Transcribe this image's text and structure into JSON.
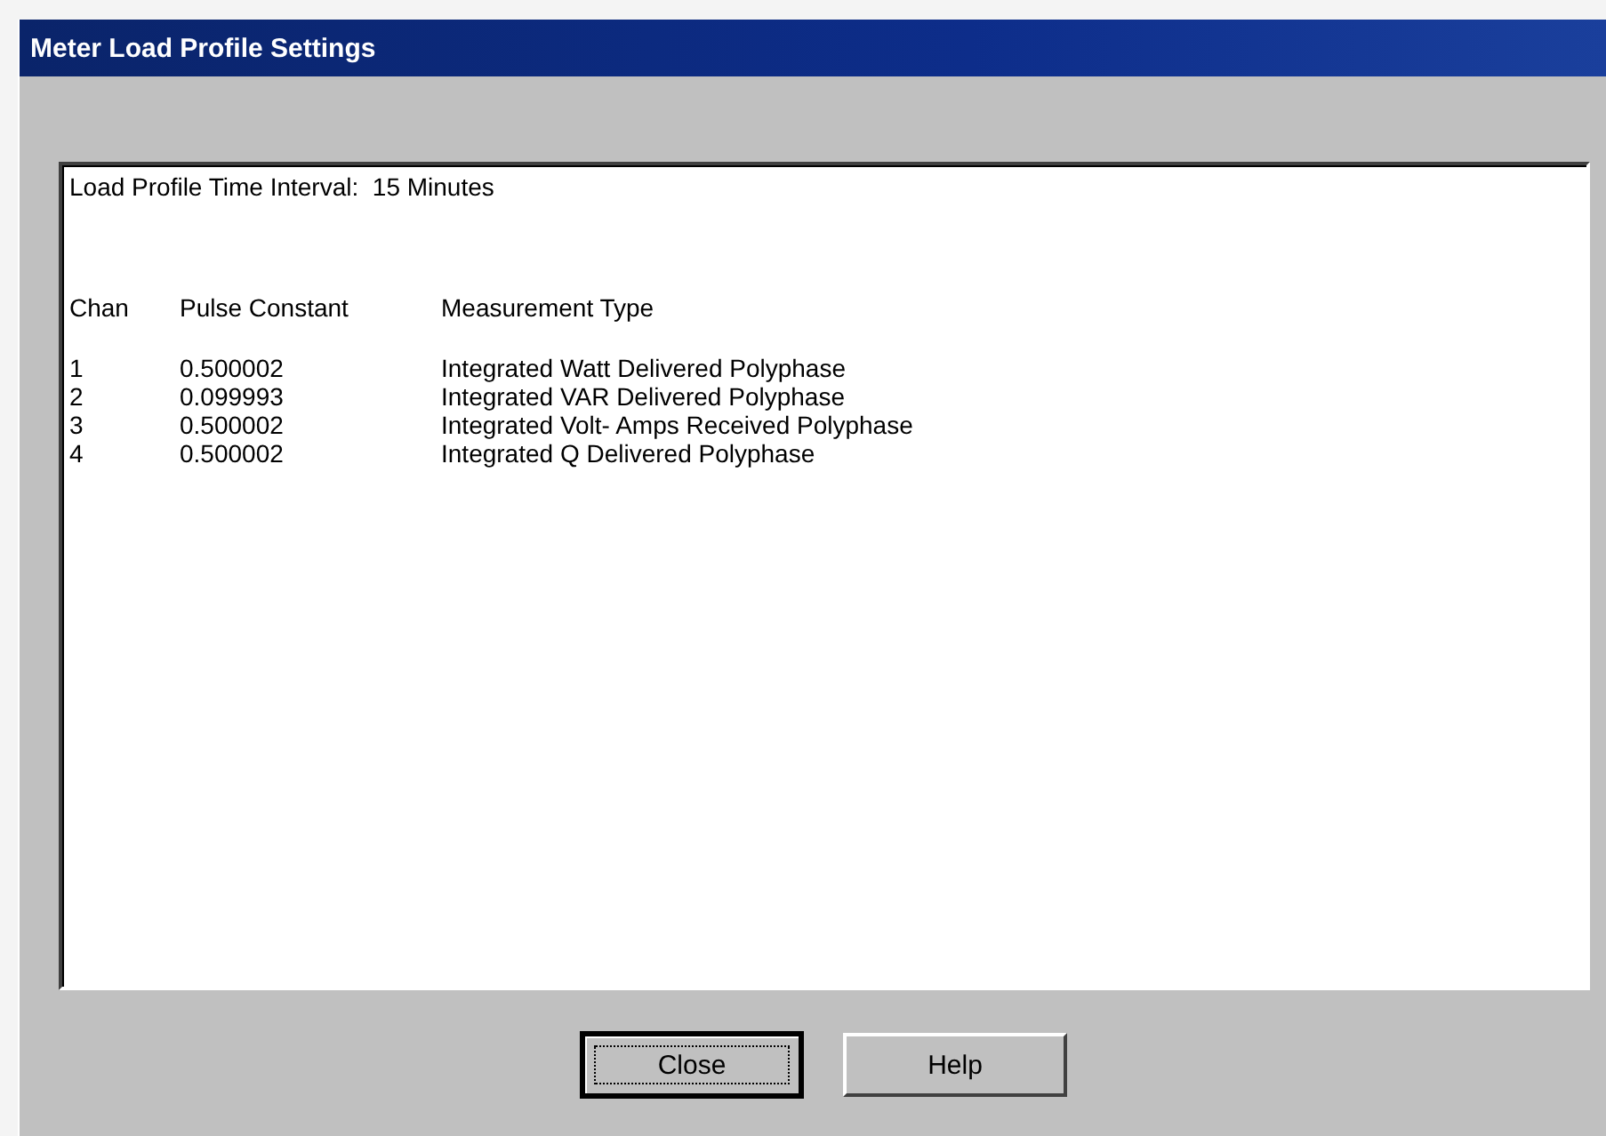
{
  "window": {
    "title": "Meter Load Profile Settings"
  },
  "interval_line": "Load Profile Time Interval:  15 Minutes",
  "table": {
    "columns": [
      "Chan",
      "Pulse Constant",
      "Measurement Type"
    ],
    "rows": [
      {
        "chan": "1",
        "pulse_constant": "0.500002",
        "measurement_type": "Integrated Watt Delivered Polyphase"
      },
      {
        "chan": "2",
        "pulse_constant": "0.099993",
        "measurement_type": "Integrated VAR Delivered Polyphase"
      },
      {
        "chan": "3",
        "pulse_constant": "0.500002",
        "measurement_type": "Integrated Volt- Amps Received Polyphase"
      },
      {
        "chan": "4",
        "pulse_constant": "0.500002",
        "measurement_type": "Integrated Q Delivered Polyphase"
      }
    ]
  },
  "buttons": [
    {
      "label": "Close",
      "focused": true
    },
    {
      "label": "Help",
      "focused": false
    }
  ]
}
